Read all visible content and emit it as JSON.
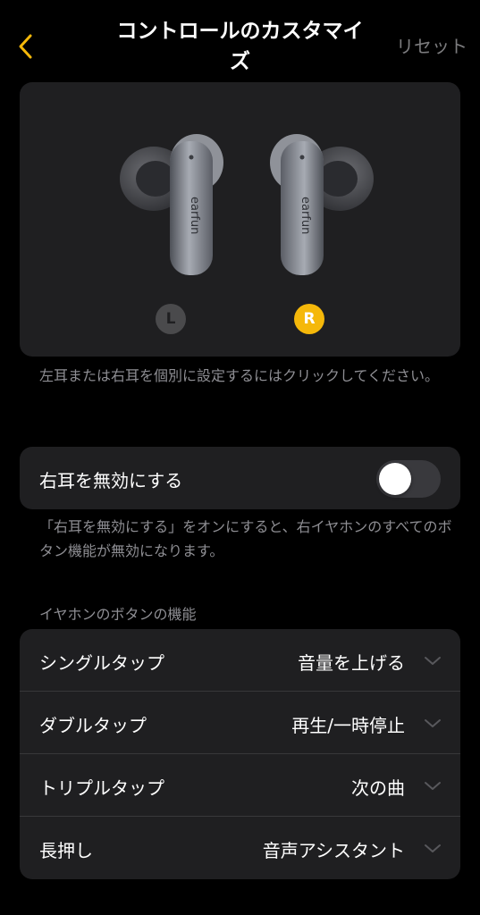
{
  "header": {
    "back_icon": "chevron-left-icon",
    "title": "コントロールのカスタマイズ",
    "reset_label": "リセット"
  },
  "colors": {
    "accent": "#f5b80a",
    "background": "#000000",
    "card": "#1f1f21",
    "secondary_text": "#8e8e93"
  },
  "earbuds": {
    "left_badge": "L",
    "right_badge": "R",
    "selected": "R",
    "hint": "左耳または右耳を個別に設定するにはクリックしてください。"
  },
  "disable": {
    "label": "右耳を無効にする",
    "enabled": false,
    "note": "「右耳を無効にする」をオンにすると、右イヤホンのすべてのボタン機能が無効になります。"
  },
  "functions": {
    "section_title": "イヤホンのボタンの機能",
    "rows": [
      {
        "label": "シングルタップ",
        "value": "音量を上げる"
      },
      {
        "label": "ダブルタップ",
        "value": "再生/一時停止"
      },
      {
        "label": "トリプルタップ",
        "value": "次の曲"
      },
      {
        "label": "長押し",
        "value": "音声アシスタント"
      }
    ]
  }
}
